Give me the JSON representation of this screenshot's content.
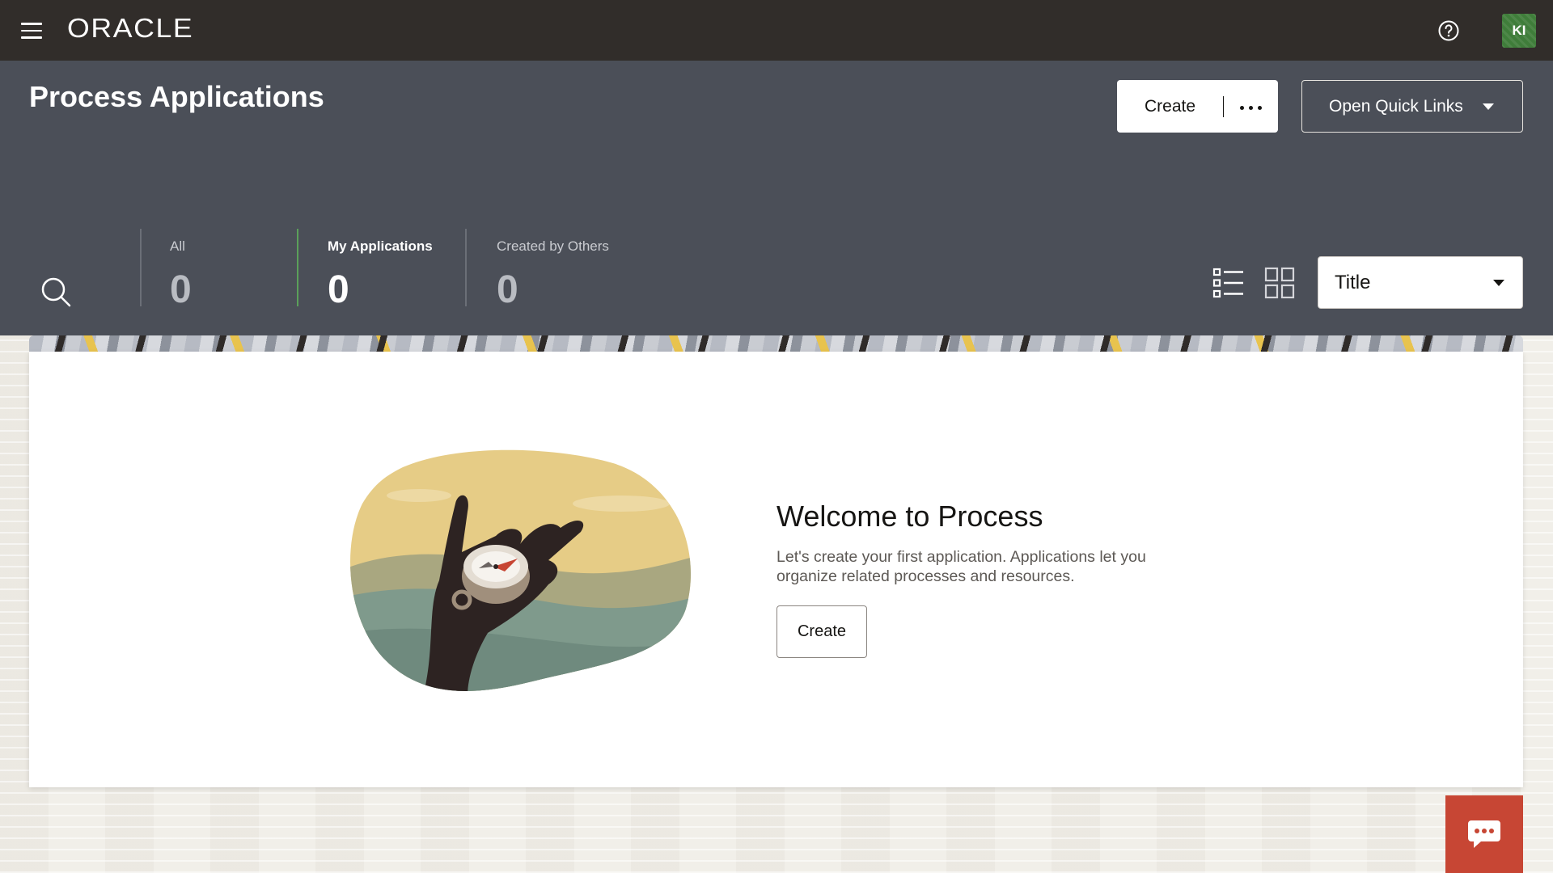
{
  "topbar": {
    "brand": "ORACLE",
    "menu_icon": "hamburger-menu-icon",
    "help_icon": "help-circle-icon",
    "user_initials": "KI"
  },
  "header": {
    "title": "Process Applications",
    "create_label": "Create",
    "more_icon": "more-dots-icon",
    "quick_links_label": "Open Quick Links",
    "search_icon": "search-icon",
    "stats": [
      {
        "label": "All",
        "count": "0"
      },
      {
        "label": "My Applications",
        "count": "0"
      },
      {
        "label": "Created by Others",
        "count": "0"
      }
    ],
    "selected_stat": "My Applications",
    "view_icons": [
      "list-view-icon",
      "grid-view-icon"
    ],
    "sort_value": "Title"
  },
  "welcome": {
    "title": "Welcome to Process",
    "description": "Let's create your first application. Applications let you organize related processes and resources.",
    "create_label": "Create",
    "illustration": "hand-holding-compass-illustration"
  },
  "chat_icon": "chat-bubble-icon",
  "colors": {
    "topbar": "#312d2a",
    "header": "#4b4f58",
    "accent_green": "#5aa05a",
    "chat_fab": "#c74634",
    "avatar": "#3f7d3a"
  }
}
